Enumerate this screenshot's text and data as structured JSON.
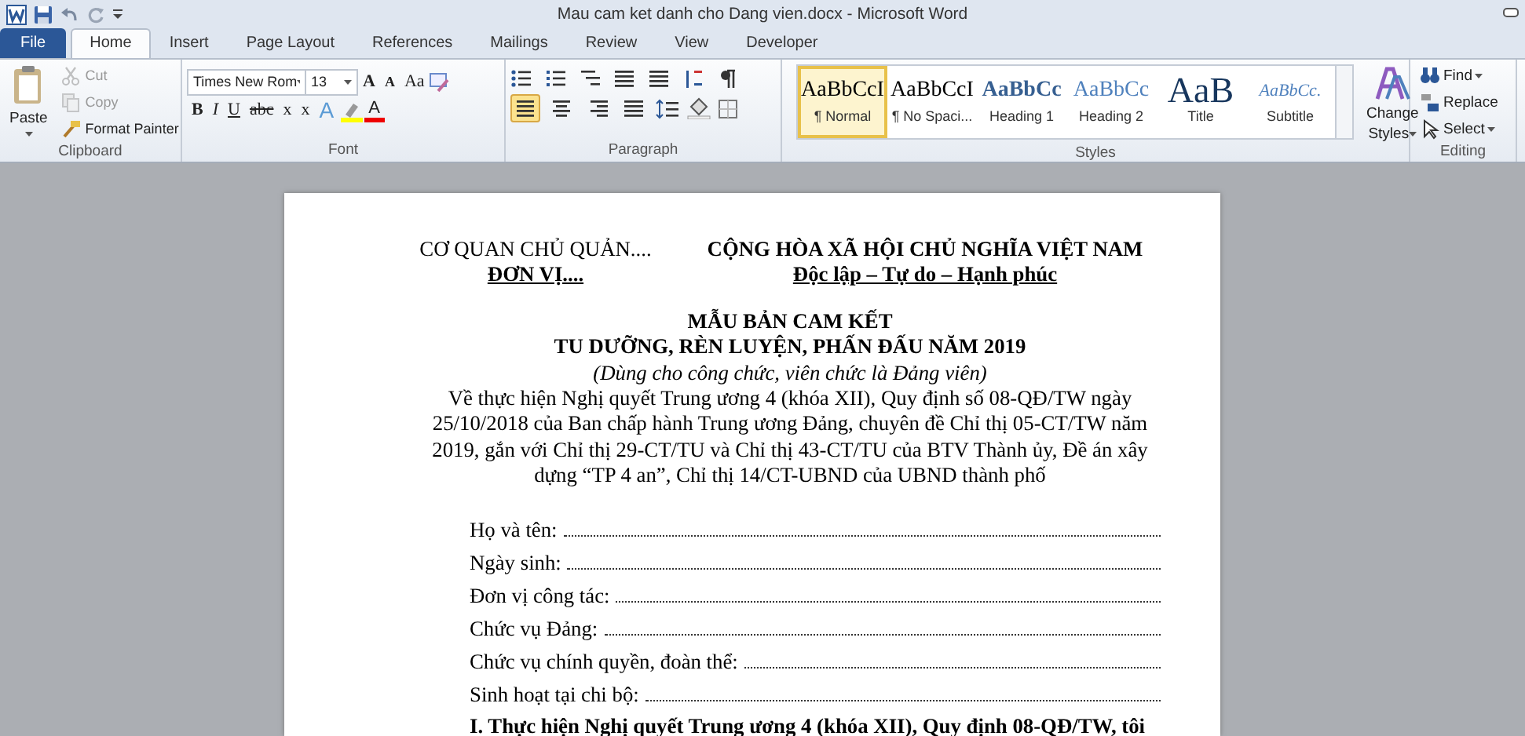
{
  "window": {
    "title": "Mau cam ket danh cho Dang vien.docx - Microsoft Word"
  },
  "tabs": [
    {
      "label": "File",
      "kind": "file",
      "selected": false
    },
    {
      "label": "Home",
      "kind": "tab",
      "selected": true
    },
    {
      "label": "Insert",
      "kind": "tab",
      "selected": false
    },
    {
      "label": "Page Layout",
      "kind": "tab",
      "selected": false
    },
    {
      "label": "References",
      "kind": "tab",
      "selected": false
    },
    {
      "label": "Mailings",
      "kind": "tab",
      "selected": false
    },
    {
      "label": "Review",
      "kind": "tab",
      "selected": false
    },
    {
      "label": "View",
      "kind": "tab",
      "selected": false
    },
    {
      "label": "Developer",
      "kind": "tab",
      "selected": false
    }
  ],
  "clipboard": {
    "label": "Clipboard",
    "paste": "Paste",
    "items": [
      {
        "label": "Cut",
        "disabled": true
      },
      {
        "label": "Copy",
        "disabled": true
      },
      {
        "label": "Format Painter",
        "disabled": false
      }
    ]
  },
  "font": {
    "label": "Font",
    "font_name": "Times New Rom",
    "font_size": "13",
    "row_1": [
      "A",
      "A",
      "Aa"
    ],
    "row_2": [
      "B",
      "I",
      "U",
      "abc",
      "x",
      "x",
      "A",
      "A"
    ]
  },
  "paragraph": {
    "label": "Paragraph",
    "alignment": [
      {
        "selected": true
      },
      {
        "selected": false
      },
      {
        "selected": false
      },
      {
        "selected": false
      }
    ]
  },
  "styles": {
    "label": "Styles",
    "items": [
      {
        "preview": "AaBbCcI",
        "name": "¶ Normal",
        "kind": "normal",
        "selected": true
      },
      {
        "preview": "AaBbCcI",
        "name": "¶ No Spaci...",
        "kind": "normal",
        "selected": false
      },
      {
        "preview": "AaBbCc",
        "name": "Heading 1",
        "kind": "heading1",
        "selected": false
      },
      {
        "preview": "AaBbCc",
        "name": "Heading 2",
        "kind": "heading2",
        "selected": false
      },
      {
        "preview": "AaB",
        "name": "Title",
        "kind": "title",
        "selected": false
      },
      {
        "preview": "AaBbCc.",
        "name": "Subtitle",
        "kind": "subtitle",
        "selected": false
      }
    ],
    "change_styles": [
      "Change",
      "Styles"
    ]
  },
  "editing": {
    "label": "Editing",
    "items": [
      "Find",
      "Replace",
      "Select"
    ]
  },
  "document": {
    "header_left": [
      "CƠ QUAN CHỦ QUẢN....",
      "ĐƠN VỊ...."
    ],
    "header_right": [
      "CỘNG HÒA XÃ HỘI CHỦ NGHĨA VIỆT NAM",
      "Độc lập – Tự do – Hạnh phúc"
    ],
    "title": [
      "MẪU BẢN CAM KẾT",
      "TU DƯỠNG, RÈN LUYỆN, PHẤN ĐẤU NĂM 2019"
    ],
    "subtitle": "(Dùng cho công chức, viên chức là Đảng viên)",
    "intro": "Về thực hiện Nghị quyết Trung ương 4 (khóa XII), Quy định số 08-QĐ/TW ngày 25/10/2018 của Ban chấp hành Trung ương Đảng, chuyên đề Chỉ thị 05-CT/TW năm 2019, gắn với Chỉ thị 29-CT/TU và Chỉ thị 43-CT/TU của BTV Thành ủy, Đề án xây dựng “TP 4 an”, Chỉ thị 14/CT-UBND của UBND thành phố",
    "fields": [
      "Họ và tên:",
      "Ngày sinh:",
      "Đơn vị công tác:",
      "Chức vụ Đảng:",
      "Chức vụ chính quyền, đoàn thể:",
      "Sinh hoạt tại chi bộ:"
    ],
    "next_line": "I. Thực hiện Nghị quyết Trung ương 4 (khóa XII), Quy định 08-QĐ/TW, tôi"
  }
}
